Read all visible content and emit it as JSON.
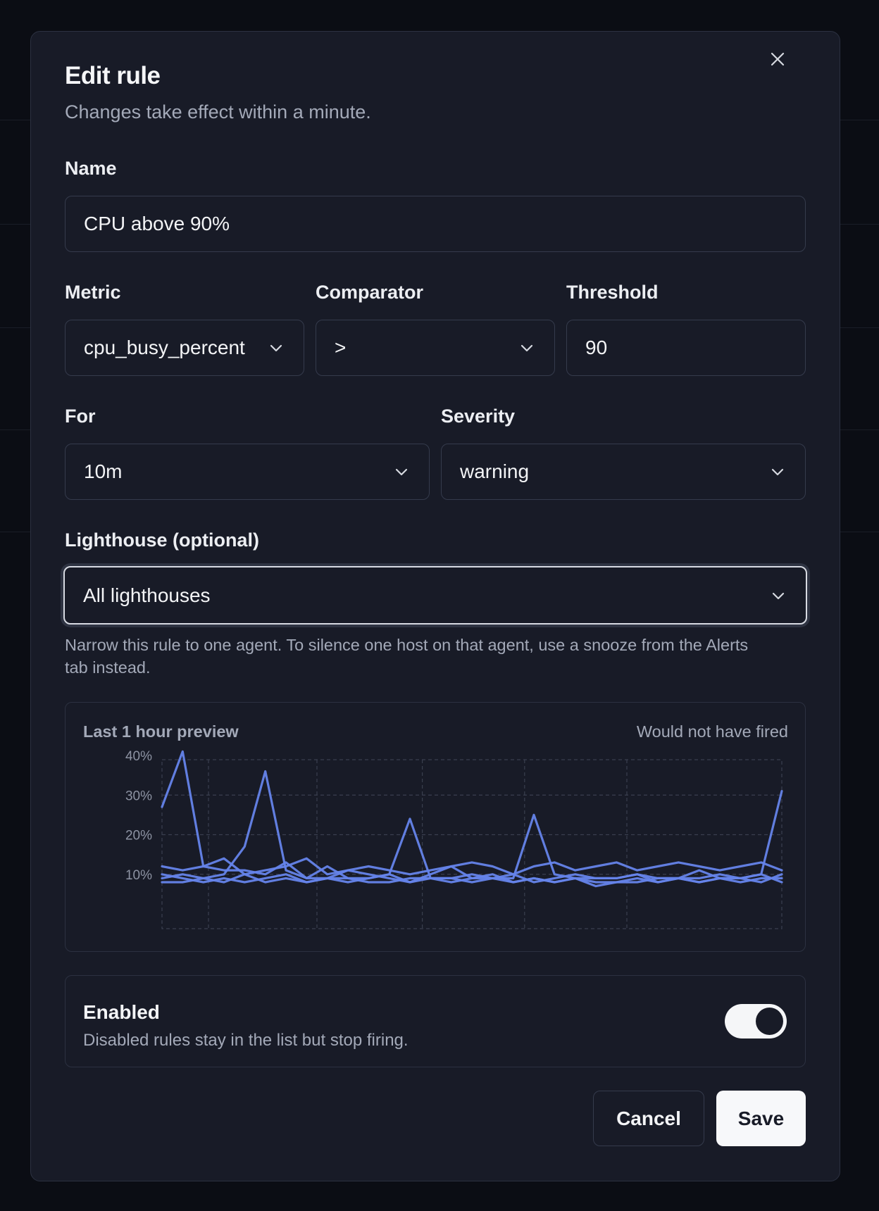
{
  "dialog": {
    "title": "Edit rule",
    "subtitle": "Changes take effect within a minute.",
    "close_icon": "close-icon"
  },
  "form": {
    "name": {
      "label": "Name",
      "value": "CPU above 90%"
    },
    "metric": {
      "label": "Metric",
      "value": "cpu_busy_percent"
    },
    "comparator": {
      "label": "Comparator",
      "value": ">"
    },
    "threshold": {
      "label": "Threshold",
      "value": "90"
    },
    "for": {
      "label": "For",
      "value": "10m"
    },
    "severity": {
      "label": "Severity",
      "value": "warning"
    },
    "lighthouse": {
      "label": "Lighthouse (optional)",
      "value": "All lighthouses",
      "help": "Narrow this rule to one agent. To silence one host on that agent, use a snooze from the Alerts tab instead."
    }
  },
  "preview": {
    "title": "Last 1 hour preview",
    "status": "Would not have fired"
  },
  "enabled": {
    "title": "Enabled",
    "description": "Disabled rules stay in the list but stop firing.",
    "on": true
  },
  "buttons": {
    "cancel": "Cancel",
    "save": "Save"
  },
  "colors": {
    "series": "#6584ea",
    "background": "#181b27",
    "border": "#2c3141"
  },
  "chart_data": {
    "type": "line",
    "title": "",
    "xlabel": "",
    "ylabel": "",
    "y_ticks": [
      "10%",
      "20%",
      "30%",
      "40%"
    ],
    "ylim": [
      0,
      40
    ],
    "x": [
      0,
      2,
      4,
      6,
      8,
      10,
      12,
      14,
      16,
      18,
      20,
      22,
      24,
      26,
      28,
      30,
      32,
      34,
      36,
      38,
      40,
      42,
      44,
      46,
      48,
      50,
      52,
      54,
      56,
      58,
      60
    ],
    "grid": true,
    "series": [
      {
        "values": [
          27,
          41,
          12,
          11,
          11,
          10,
          13,
          9,
          9,
          11,
          10,
          9,
          8,
          10,
          12,
          9,
          9,
          10,
          8,
          9,
          10,
          9,
          9,
          10,
          8,
          9,
          11,
          9,
          9,
          10,
          8
        ]
      },
      {
        "values": [
          9,
          10,
          9,
          10,
          17,
          36,
          11,
          9,
          12,
          9,
          9,
          10,
          24,
          9,
          9,
          10,
          9,
          9,
          25,
          10,
          9,
          9,
          9,
          10,
          9,
          9,
          9,
          10,
          9,
          10,
          31
        ]
      },
      {
        "values": [
          8,
          8,
          9,
          8,
          10,
          8,
          9,
          8,
          9,
          9,
          8,
          8,
          9,
          9,
          9,
          8,
          9,
          8,
          9,
          8,
          9,
          8,
          8,
          8,
          9,
          9,
          8,
          9,
          9,
          8,
          10
        ]
      },
      {
        "values": [
          12,
          11,
          12,
          14,
          10,
          11,
          12,
          14,
          10,
          11,
          12,
          11,
          10,
          11,
          12,
          13,
          12,
          10,
          12,
          13,
          11,
          12,
          13,
          11,
          12,
          13,
          12,
          11,
          12,
          13,
          11
        ]
      },
      {
        "values": [
          10,
          9,
          8,
          9,
          8,
          9,
          10,
          8,
          9,
          8,
          9,
          10,
          8,
          9,
          8,
          9,
          10,
          8,
          9,
          8,
          9,
          7,
          8,
          9,
          8,
          9,
          8,
          9,
          8,
          9,
          9
        ]
      }
    ]
  }
}
